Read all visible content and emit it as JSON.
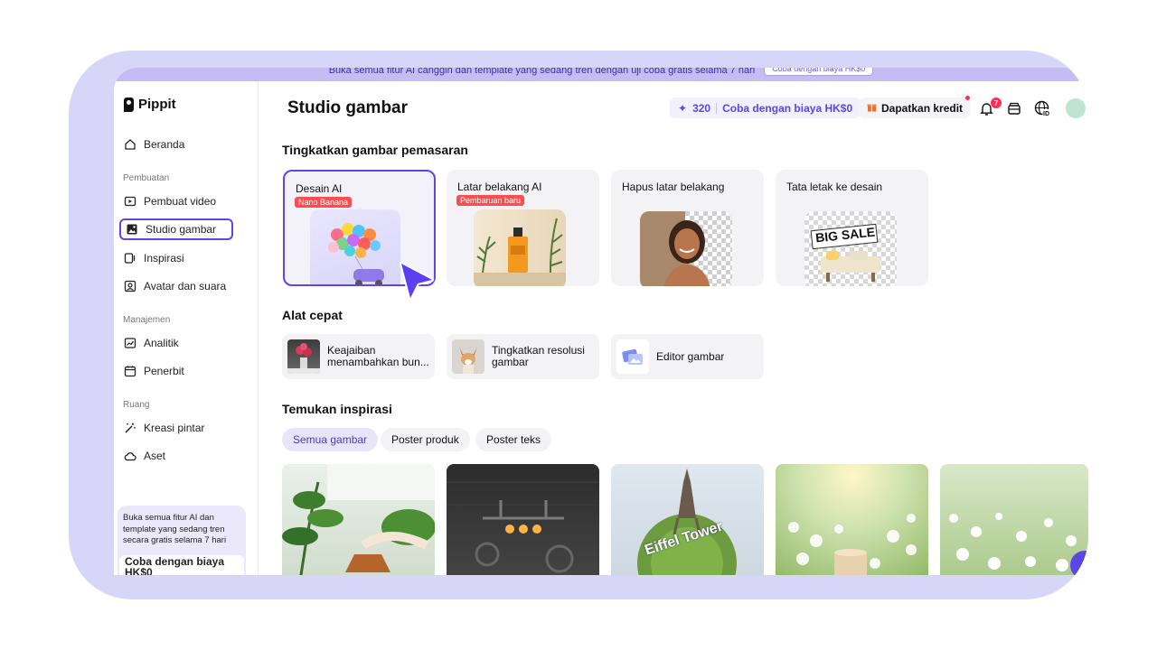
{
  "promo_bar": {
    "text": "Buka semua fitur AI canggih dan template yang sedang tren dengan uji coba gratis selama 7 hari",
    "button": "Coba dengan biaya HK$0"
  },
  "brand": {
    "name": "Pippit"
  },
  "sidebar": {
    "home": "Beranda",
    "section_create": "Pembuatan",
    "create_items": [
      "Pembuat video",
      "Studio gambar",
      "Inspirasi",
      "Avatar dan suara"
    ],
    "section_manage": "Manajemen",
    "manage_items": [
      "Analitik",
      "Penerbit"
    ],
    "section_space": "Ruang",
    "space_items": [
      "Kreasi pintar",
      "Aset"
    ],
    "promo_text": "Buka semua fitur AI dan template yang sedang tren secara gratis selama 7 hari",
    "promo_button": "Coba dengan biaya HK$0"
  },
  "header": {
    "title": "Studio gambar",
    "credits": "320",
    "try_label": "Coba dengan biaya HK$0",
    "get_credit": "Dapatkan kredit",
    "notification_count": "7"
  },
  "section_enhance": {
    "title": "Tingkatkan gambar pemasaran",
    "cards": [
      {
        "title": "Desain AI",
        "tag": "Nano Banana"
      },
      {
        "title": "Latar belakang AI",
        "tag": "Pembaruan baru"
      },
      {
        "title": "Hapus latar belakang",
        "tag": ""
      },
      {
        "title": "Tata letak ke desain",
        "tag": ""
      }
    ],
    "sale_text": "BIG SALE"
  },
  "section_tools": {
    "title": "Alat cepat",
    "items": [
      "Keajaiban menambahkan bun...",
      "Tingkatkan resolusi gambar",
      "Editor gambar"
    ]
  },
  "section_inspire": {
    "title": "Temukan inspirasi",
    "chips": [
      "Semua gambar",
      "Poster produk",
      "Poster teks"
    ],
    "globe_text": "Eiffel Tower"
  },
  "colors": {
    "accent": "#5b46e6",
    "frame": "#d7d6f8",
    "tag": "#ff4d4f"
  }
}
